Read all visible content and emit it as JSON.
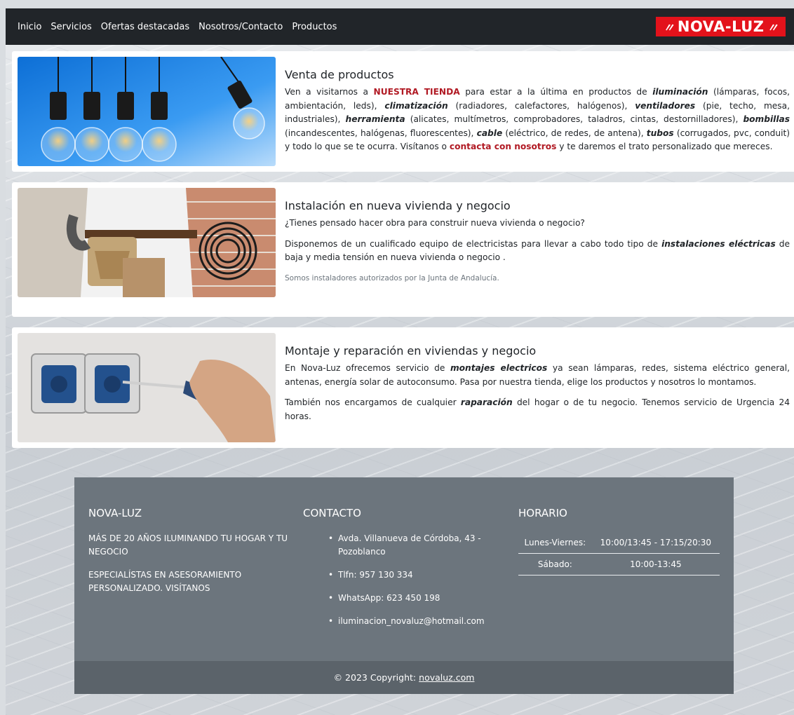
{
  "nav": {
    "links": [
      "Inicio",
      "Servicios",
      "Ofertas destacadas",
      "Nosotros/Contacto",
      "Productos"
    ],
    "logo": "NOVA-LUZ",
    "logo_glyph": "〃"
  },
  "cards": [
    {
      "title": "Venta de productos",
      "p1": {
        "a": "Ven a visitarnos a ",
        "tienda": "NUESTRA TIENDA",
        "b": " para estar a la última en productos de ",
        "iluminacion": "iluminación",
        "c": " (lámparas, focos, ambientación, leds), ",
        "climatizacion": "climatización",
        "d": " (radiadores, calefactores, halógenos), ",
        "ventiladores": "ventiladores",
        "e": " (pie, techo, mesa, industriales), ",
        "herramienta": "herramienta",
        "f": " (alicates, multímetros, comprobadores, taladros, cintas, destornilladores), ",
        "bombillas": "bombillas",
        "g": " (incandescentes, halógenas, fluorescentes), ",
        "cable": "cable",
        "h": " (eléctrico, de redes, de antena), ",
        "tubos": "tubos",
        "i": " (corrugados, pvc, conduit) y todo lo que se te ocurra. Visítanos o ",
        "contacta": "contacta con nosotros",
        "j": " y te daremos el trato personalizado que mereces."
      }
    },
    {
      "title": "Instalación en nueva vivienda y negocio",
      "p1": "¿Tienes pensado hacer obra para construir nueva vivienda o negocio?",
      "p2a": "Disponemos de un cualificado equipo de electricistas para llevar a cabo todo tipo de ",
      "p2em": "instalaciones eléctricas",
      "p2b": " de baja y media tensión en nueva vivienda o negocio .",
      "muted": "Somos instaladores autorizados por la Junta de Andalucía."
    },
    {
      "title": "Montaje y reparación en viviendas y negocio",
      "p1a": "En Nova-Luz ofrecemos servicio de ",
      "p1em": "montajes electricos",
      "p1b": " ya sean lámparas, redes, sistema eléctrico general, antenas, energía solar de autoconsumo. Pasa por nuestra tienda, elige los productos y nosotros lo montamos.",
      "p2a": "También nos encargamos de cualquier ",
      "p2em": "raparación",
      "p2b": " del hogar o de tu negocio. Tenemos servicio de Urgencia 24 horas."
    }
  ],
  "footer": {
    "col1": {
      "title": "NOVA-LUZ",
      "texts": [
        "Más de 20 años iluminando tu hogar y tu negocio",
        "Especialístas en asesoramiento personalizado. Visítanos"
      ]
    },
    "col2": {
      "title": "CONTACTO",
      "items": [
        "Avda. Villanueva de Córdoba, 43 - Pozoblanco",
        "Tlfn: 957 130 334",
        "WhatsApp: 623 450 198",
        "iluminacion_novaluz@hotmail.com"
      ]
    },
    "col3": {
      "title": "HORARIO",
      "rows": [
        {
          "day": "Lunes-Viernes:",
          "hours": "10:00/13:45 - 17:15/20:30"
        },
        {
          "day": "Sábado:",
          "hours": "10:00-13:45"
        }
      ]
    },
    "copyright": "© 2023 Copyright:",
    "copyright_link": "novaluz.com"
  },
  "colors": {
    "nav_bg": "#212529",
    "logo_bg": "#e3121b",
    "accent_red": "#b11a24",
    "footer_bg": "#6c757d",
    "copyright_bg": "#5b636a"
  }
}
